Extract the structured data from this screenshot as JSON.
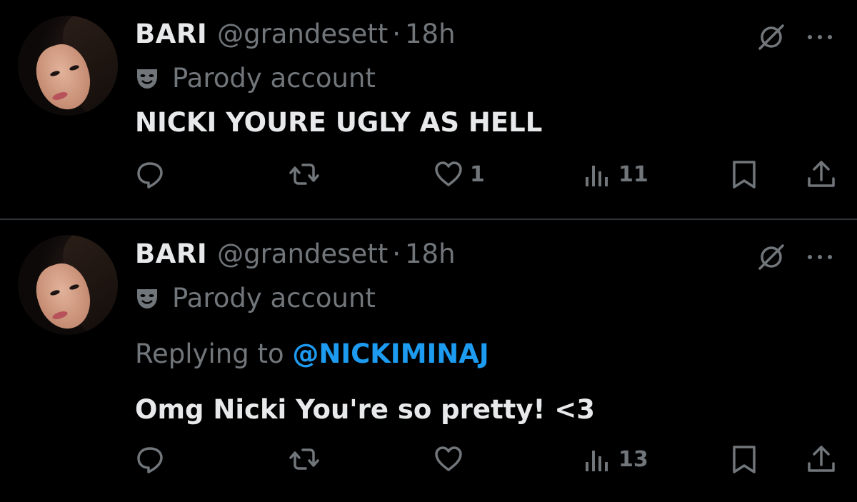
{
  "tweets": [
    {
      "name": "BARI",
      "handle": "@grandesett",
      "separator": "·",
      "time": "18h",
      "parody_label": "Parody account",
      "text": "NICKI YOURE UGLY AS HELL",
      "likes": "1",
      "views": "11"
    },
    {
      "name": "BARI",
      "handle": "@grandesett",
      "separator": "·",
      "time": "18h",
      "parody_label": "Parody account",
      "replying_prefix": "Replying to",
      "replying_mention": "@NICKIMINAJ",
      "text": "Omg Nicki You're so pretty! <3",
      "likes": "",
      "views": "13"
    }
  ],
  "colors": {
    "background": "#000000",
    "primary_text": "#e7e9ea",
    "secondary_text": "#71767b",
    "mention": "#1d9bf0",
    "divider": "#2f3336"
  },
  "icons": [
    "theater-mask-icon",
    "grok-icon",
    "more-icon",
    "reply-icon",
    "retweet-icon",
    "like-icon",
    "views-icon",
    "bookmark-icon",
    "share-icon"
  ]
}
